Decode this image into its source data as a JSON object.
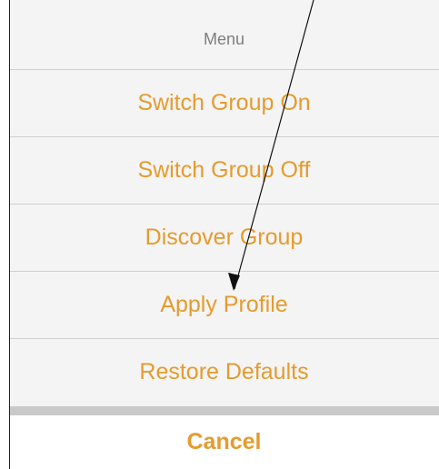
{
  "sheet": {
    "title": "Menu",
    "actions": [
      {
        "label": "Switch Group On"
      },
      {
        "label": "Switch Group Off"
      },
      {
        "label": "Discover Group"
      },
      {
        "label": "Apply Profile"
      },
      {
        "label": "Restore Defaults"
      }
    ],
    "cancel_label": "Cancel"
  },
  "colors": {
    "accent": "#e59b2e",
    "sheet_bg": "#f4f4f4",
    "separator": "#d0d0d0",
    "title_text": "#7e7e7e"
  },
  "annotation": {
    "type": "arrow",
    "points_to": "Apply Profile"
  }
}
